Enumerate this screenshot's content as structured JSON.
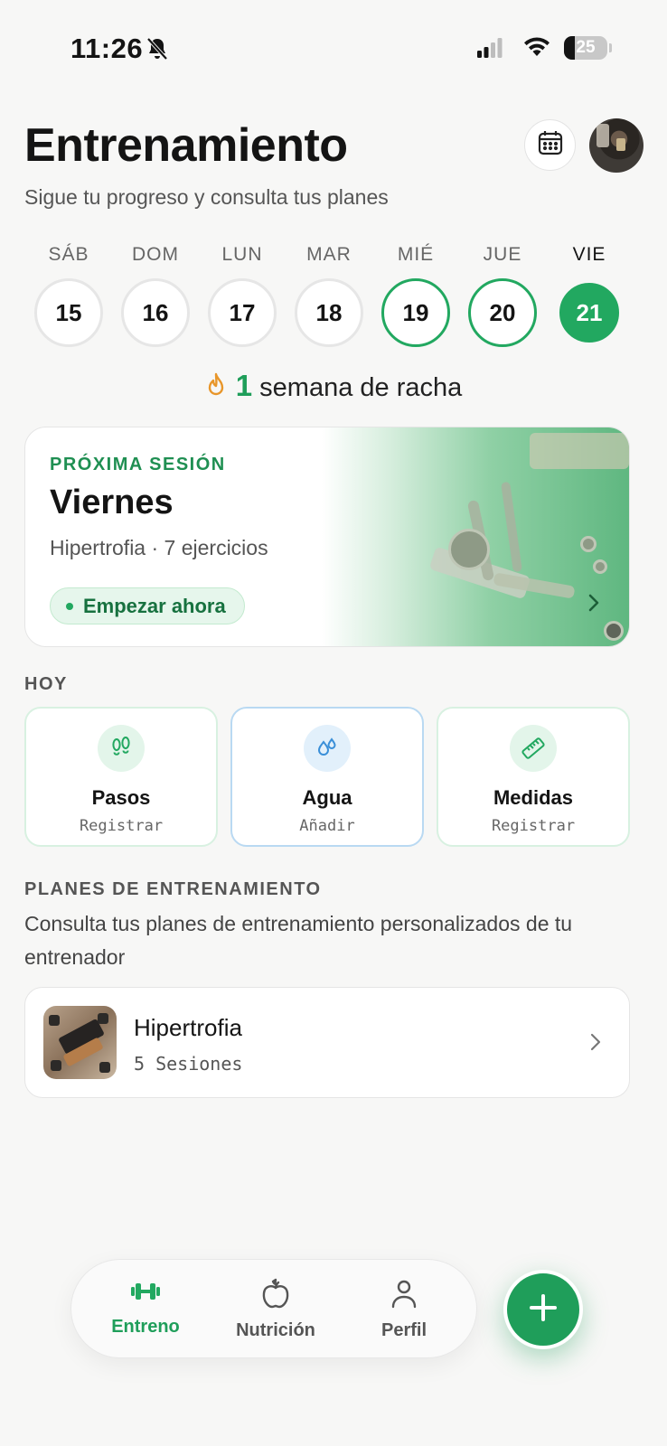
{
  "status_bar": {
    "time": "11:26",
    "battery_level": "25",
    "battery_fraction": 0.25
  },
  "header": {
    "title": "Entrenamiento",
    "subtitle": "Sigue tu progreso y consulta tus planes",
    "calendar_icon": "calendar-icon",
    "avatar": "profile-photo"
  },
  "week": [
    {
      "label": "SÁB",
      "date": "15",
      "state": "none"
    },
    {
      "label": "DOM",
      "date": "16",
      "state": "none"
    },
    {
      "label": "LUN",
      "date": "17",
      "state": "none"
    },
    {
      "label": "MAR",
      "date": "18",
      "state": "none"
    },
    {
      "label": "MIÉ",
      "date": "19",
      "state": "done"
    },
    {
      "label": "JUE",
      "date": "20",
      "state": "done"
    },
    {
      "label": "VIE",
      "date": "21",
      "state": "today"
    }
  ],
  "streak": {
    "count": "1",
    "text": "semana de racha",
    "icon": "flame-icon"
  },
  "next_session": {
    "kicker": "PRÓXIMA SESIÓN",
    "day": "Viernes",
    "meta": "Hipertrofia · 7 ejercicios",
    "cta": "Empezar ahora"
  },
  "today": {
    "label": "HOY",
    "tiles": [
      {
        "title": "Pasos",
        "action": "Registrar",
        "icon": "footsteps-icon"
      },
      {
        "title": "Agua",
        "action": "Añadir",
        "icon": "water-drops-icon"
      },
      {
        "title": "Medidas",
        "action": "Registrar",
        "icon": "ruler-icon"
      }
    ]
  },
  "plans": {
    "label": "PLANES DE ENTRENAMIENTO",
    "description": "Consulta tus planes de entrenamiento personalizados de tu entrenador",
    "items": [
      {
        "name": "Hipertrofia",
        "sessions": "5 Sesiones"
      }
    ]
  },
  "bottom_nav": {
    "items": [
      {
        "label": "Entreno",
        "icon": "dumbbell-icon",
        "active": true
      },
      {
        "label": "Nutrición",
        "icon": "apple-icon",
        "active": false
      },
      {
        "label": "Perfil",
        "icon": "person-icon",
        "active": false
      }
    ],
    "fab_icon": "plus-icon"
  },
  "colors": {
    "accent": "#22a860",
    "background": "#f7f7f6",
    "water_accent": "#3a8fd8"
  }
}
